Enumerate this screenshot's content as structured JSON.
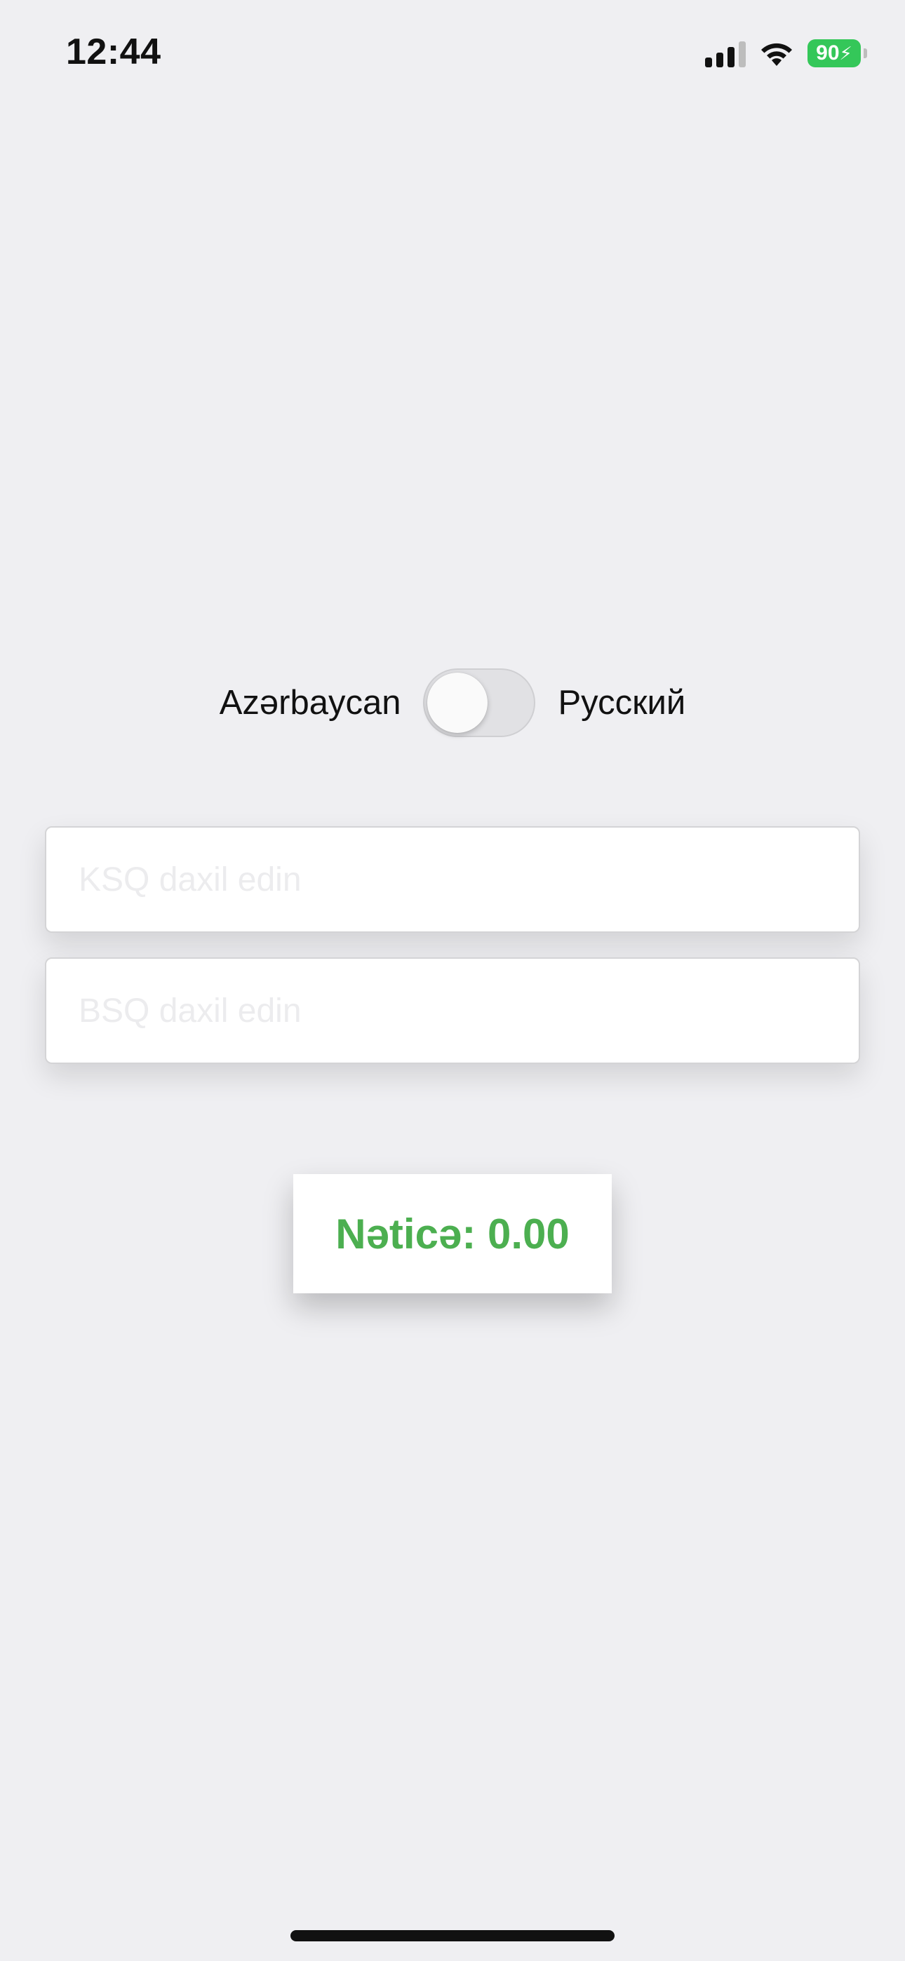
{
  "status_bar": {
    "time": "12:44",
    "battery_level": "90",
    "icons": [
      "signal-icon",
      "wifi-icon",
      "battery-charging-icon"
    ]
  },
  "language_toggle": {
    "left_label": "Azərbaycan",
    "right_label": "Русский",
    "is_on": false
  },
  "inputs": {
    "ksq_placeholder": "KSQ daxil edin",
    "ksq_value": "",
    "bsq_placeholder": "BSQ daxil edin",
    "bsq_value": ""
  },
  "result": {
    "text": "Nəticə: 0.00"
  },
  "colors": {
    "background": "#efeff2",
    "result_text": "#4caf50",
    "battery": "#34c759"
  }
}
